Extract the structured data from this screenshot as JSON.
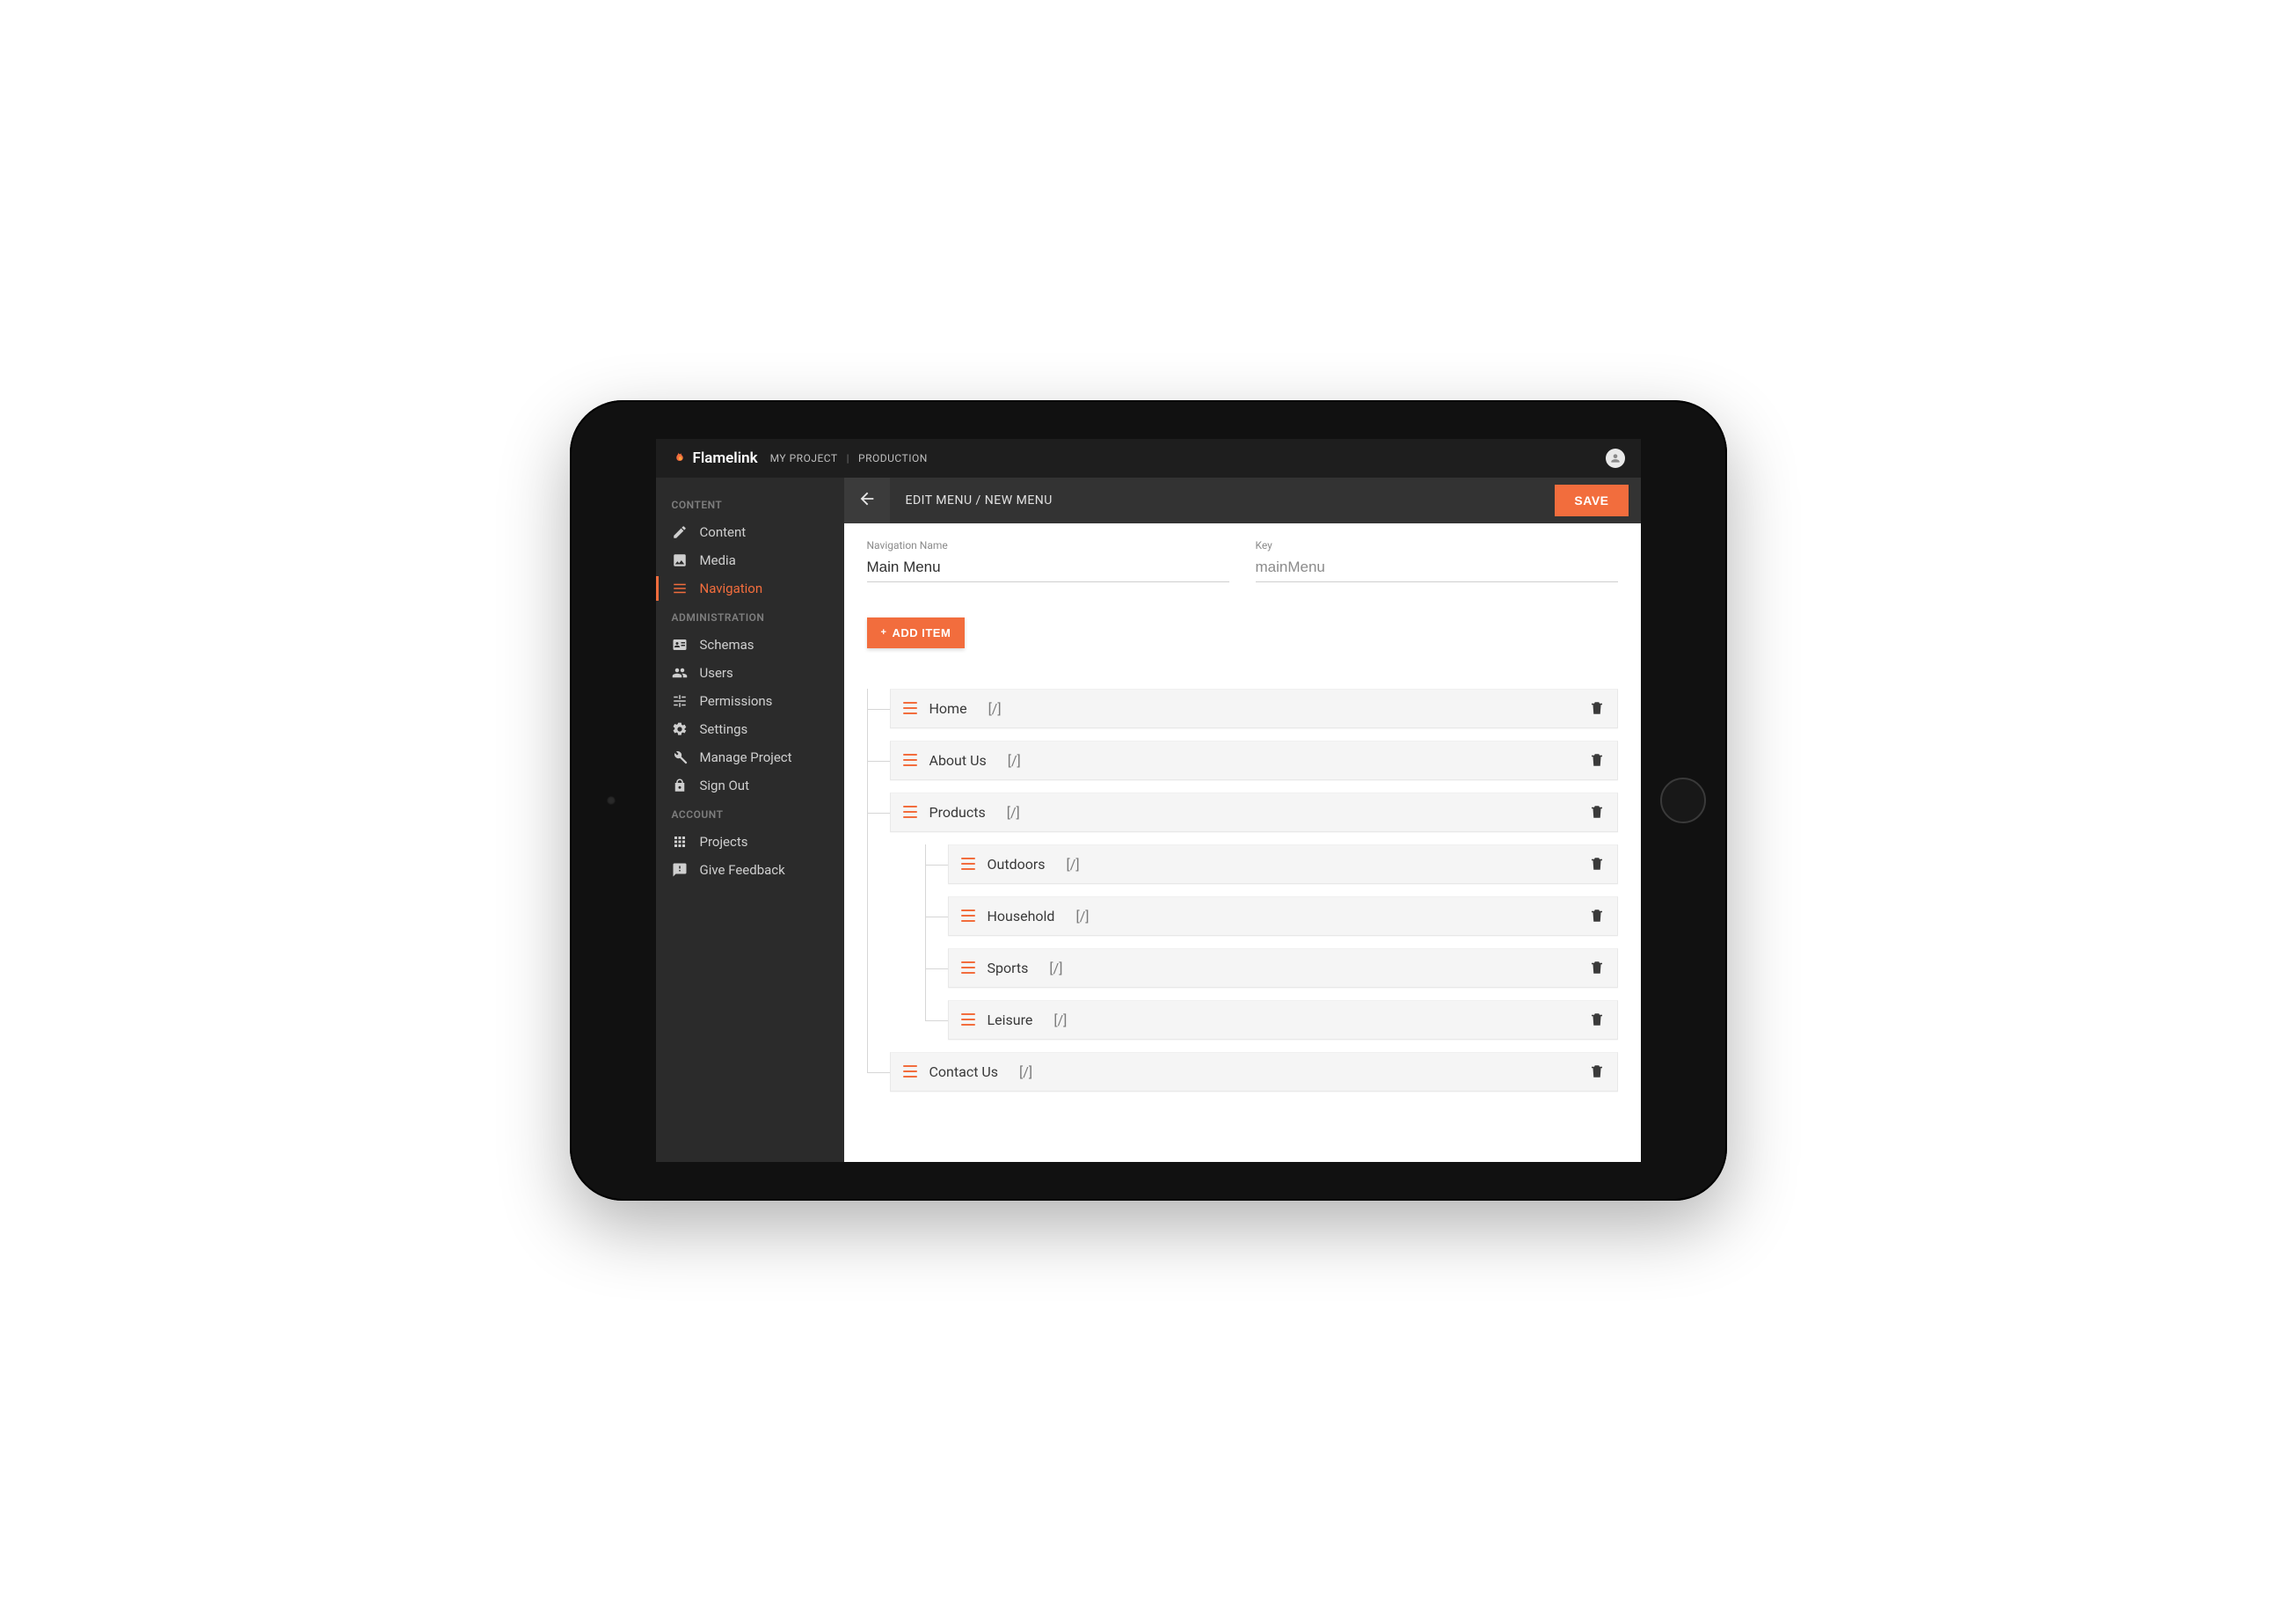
{
  "brand": "Flamelink",
  "header": {
    "crumbs": [
      "MY PROJECT",
      "PRODUCTION"
    ],
    "separator": "|"
  },
  "sidebar": {
    "sections": [
      {
        "heading": "CONTENT",
        "items": [
          {
            "label": "Content",
            "icon": "pencil"
          },
          {
            "label": "Media",
            "icon": "image"
          },
          {
            "label": "Navigation",
            "icon": "list",
            "active": true
          }
        ]
      },
      {
        "heading": "ADMINISTRATION",
        "items": [
          {
            "label": "Schemas",
            "icon": "id-card"
          },
          {
            "label": "Users",
            "icon": "users"
          },
          {
            "label": "Permissions",
            "icon": "sliders"
          },
          {
            "label": "Settings",
            "icon": "gear"
          },
          {
            "label": "Manage Project",
            "icon": "wrench"
          },
          {
            "label": "Sign Out",
            "icon": "lock"
          }
        ]
      },
      {
        "heading": "ACCOUNT",
        "items": [
          {
            "label": "Projects",
            "icon": "grid"
          },
          {
            "label": "Give Feedback",
            "icon": "feedback"
          }
        ]
      }
    ]
  },
  "page": {
    "title": "EDIT MENU / NEW MENU",
    "save_label": "SAVE",
    "fields": {
      "name_label": "Navigation Name",
      "name_value": "Main Menu",
      "key_label": "Key",
      "key_value": "mainMenu"
    },
    "add_item_label": "ADD ITEM",
    "items": [
      {
        "title": "Home",
        "path": "[/]",
        "children": []
      },
      {
        "title": "About Us",
        "path": "[/]",
        "children": []
      },
      {
        "title": "Products",
        "path": "[/]",
        "children": [
          {
            "title": "Outdoors",
            "path": "[/]"
          },
          {
            "title": "Household",
            "path": "[/]"
          },
          {
            "title": "Sports",
            "path": "[/]"
          },
          {
            "title": "Leisure",
            "path": "[/]"
          }
        ]
      },
      {
        "title": "Contact Us",
        "path": "[/]",
        "children": []
      }
    ]
  },
  "colors": {
    "accent": "#f26d3d"
  }
}
